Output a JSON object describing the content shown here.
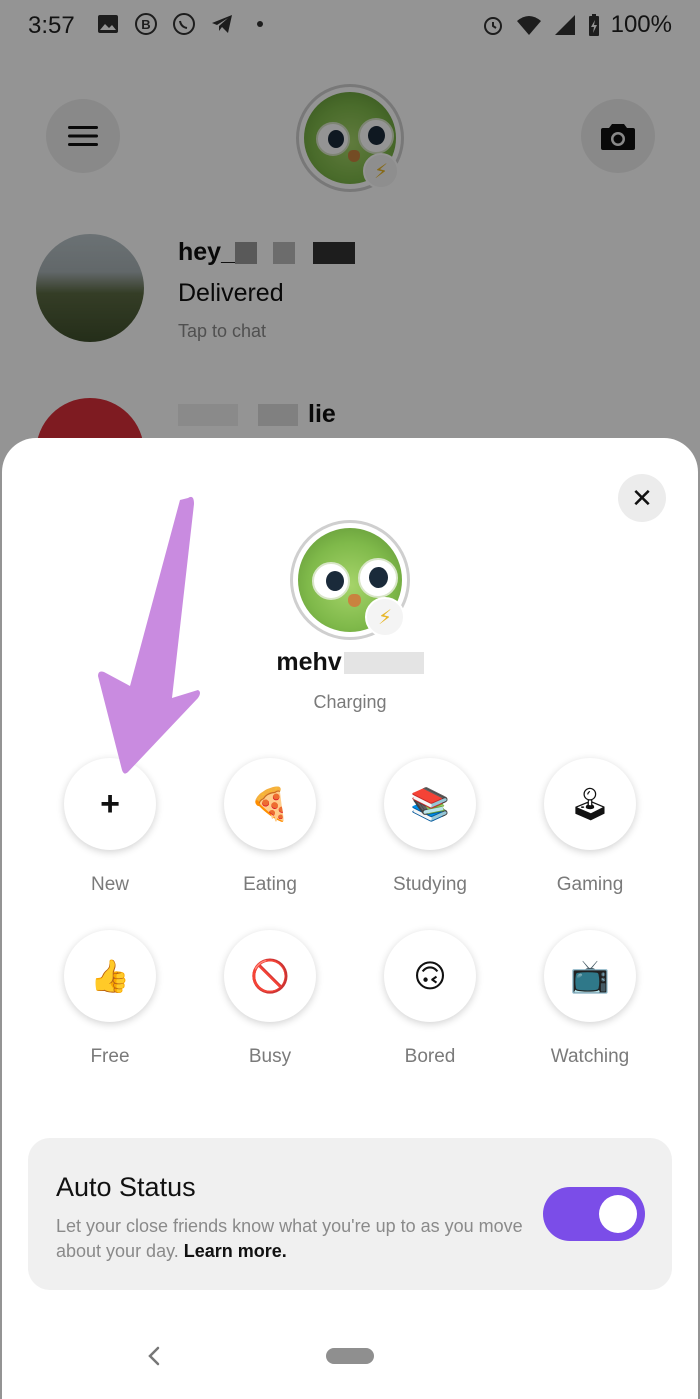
{
  "status_bar": {
    "time": "3:57",
    "battery": "100%",
    "left_icons": [
      "image-icon",
      "b-icon",
      "whatsapp-icon",
      "telegram-icon",
      "dot-icon"
    ],
    "right_icons": [
      "alarm-icon",
      "wifi-icon",
      "signal-icon",
      "battery-icon"
    ]
  },
  "chats": [
    {
      "name": "hey_",
      "status": "Delivered",
      "hint": "Tap to chat"
    },
    {
      "name": "lie"
    }
  ],
  "sheet": {
    "close_label": "✕",
    "profile_name": "mehv",
    "profile_status": "Charging",
    "statuses": [
      {
        "label": "New",
        "icon": "plus-icon",
        "glyph": "+"
      },
      {
        "label": "Eating",
        "icon": "pizza-icon",
        "glyph": "🍕"
      },
      {
        "label": "Studying",
        "icon": "books-icon",
        "glyph": "📚"
      },
      {
        "label": "Gaming",
        "icon": "joystick-icon",
        "glyph": "🕹"
      },
      {
        "label": "Free",
        "icon": "thumbs-up-icon",
        "glyph": "👍"
      },
      {
        "label": "Busy",
        "icon": "prohibited-icon",
        "glyph": "🚫"
      },
      {
        "label": "Bored",
        "icon": "upside-down-face-icon",
        "glyph": "🙃"
      },
      {
        "label": "Watching",
        "icon": "tv-icon",
        "glyph": "📺"
      }
    ],
    "auto_status": {
      "title": "Auto Status",
      "description": "Let your close friends know what you're up to as you move about your day.",
      "learn_more": "Learn more.",
      "enabled": true
    }
  },
  "colors": {
    "toggle_on": "#7b4de8",
    "annotation_arrow": "#c98be0",
    "badge_bolt": "#e7b72a"
  }
}
